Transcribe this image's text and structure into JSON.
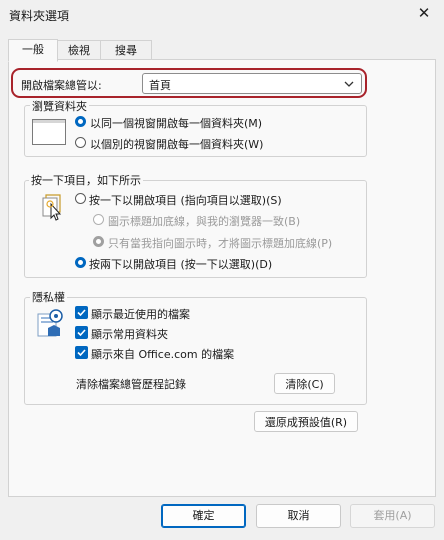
{
  "window": {
    "title": "資料夾選項",
    "close_glyph": "✕"
  },
  "tabs": [
    {
      "label": "一般",
      "active": true
    },
    {
      "label": "檢視",
      "active": false
    },
    {
      "label": "搜尋",
      "active": false
    }
  ],
  "open_explorer": {
    "label": "開啟檔案總管以:",
    "value": "首頁"
  },
  "browse_folders": {
    "title": "瀏覽資料夾",
    "options": [
      {
        "label": "以同一個視窗開啟每一個資料夾(M)",
        "checked": true
      },
      {
        "label": "以個別的視窗開啟每一個資料夾(W)",
        "checked": false
      }
    ]
  },
  "click_items": {
    "title": "按一下項目，如下所示",
    "single_click": {
      "label": "按一下以開啟項目 (指向項目以選取)(S)",
      "checked": false
    },
    "sub_options": [
      {
        "label": "圖示標題加底線，與我的瀏覽器一致(B)",
        "checked": false,
        "enabled": false
      },
      {
        "label": "只有當我指向圖示時，才將圖示標題加底線(P)",
        "checked": true,
        "enabled": false
      }
    ],
    "double_click": {
      "label": "按兩下以開啟項目 (按一下以選取)(D)",
      "checked": true
    }
  },
  "privacy": {
    "title": "隱私權",
    "checks": [
      {
        "label": "顯示最近使用的檔案",
        "checked": true
      },
      {
        "label": "顯示常用資料夾",
        "checked": true
      },
      {
        "label": "顯示來自 Office.com 的檔案",
        "checked": true
      }
    ],
    "clear_label": "清除檔案總管歷程記錄",
    "clear_button": "清除(C)"
  },
  "restore_defaults": "還原成預設值(R)",
  "footer": {
    "ok": "確定",
    "cancel": "取消",
    "apply": "套用(A)"
  },
  "colors": {
    "accent": "#0067c0",
    "highlight_border": "#a8232b"
  }
}
